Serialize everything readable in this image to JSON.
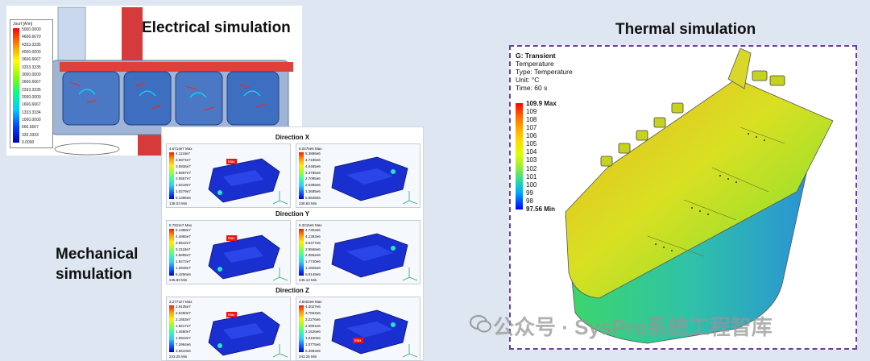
{
  "labels": {
    "electrical": "Electrical simulation",
    "mechanical_line1": "Mechanical",
    "mechanical_line2": "simulation",
    "thermal": "Thermal simulation"
  },
  "electrical_legend": {
    "title": "Jourf [A/m]",
    "values": [
      "5000.0000",
      "4666.6670",
      "4333.3335",
      "4000.0000",
      "3666.6667",
      "3333.3335",
      "3000.0000",
      "2666.6667",
      "2333.3335",
      "2000.0000",
      "1666.6667",
      "1333.3334",
      "1000.0000",
      "666.6667",
      "333.3333",
      "0.0000"
    ]
  },
  "mechanical": {
    "rows": [
      {
        "title": "Direction X",
        "left": {
          "header": "4.6714e7 Max",
          "values": [
            "4.1116e7",
            "3.5874e7",
            "3.0836e7",
            "2.5897e7",
            "2.0557e7",
            "1.5418e7",
            "1.0279e7",
            "5.1396e6"
          ],
          "footer": "138.03 Min"
        },
        "right": {
          "header": "6.0475e6 Max",
          "values": [
            "5.3886e6",
            "4.7186e6",
            "4.0485e6",
            "3.3785e6",
            "2.7085e6",
            "2.0385e6",
            "1.3685e6",
            "6.9848e5"
          ],
          "footer": "238.83 Min"
        }
      },
      {
        "title": "Direction Y",
        "left": {
          "header": "5.7811e7 Max",
          "values": [
            "5.1388e7",
            "4.4965e7",
            "3.8542e7",
            "3.2118e7",
            "2.5695e7",
            "1.9272e7",
            "1.2849e7",
            "6.4256e6"
          ],
          "footer": "245.93 Min"
        },
        "right": {
          "header": "5.3215e6 Max",
          "values": [
            "4.7303e6",
            "4.1392e6",
            "3.5477e6",
            "2.9566e6",
            "2.3652e6",
            "1.7740e6",
            "1.1825e6",
            "5.9149e5"
          ],
          "footer": "245.13 Min"
        }
      },
      {
        "title": "Direction Z",
        "left": {
          "header": "3.2771e7 Max",
          "values": [
            "2.9135e7",
            "2.5490e7",
            "2.1853e7",
            "1.8217e7",
            "1.4580e7",
            "1.0943e7",
            "7.2984e6",
            "3.6610e6"
          ],
          "footer": "243.25 Min"
        },
        "right": {
          "header": "4.8402e6 Max",
          "values": [
            "4.3027e6",
            "3.7652e6",
            "3.2276e6",
            "2.6901e6",
            "2.1526e6",
            "1.6150e6",
            "1.0775e6",
            "5.3994e5"
          ],
          "footer": "243.25 Min"
        }
      }
    ],
    "max_tag": "Max"
  },
  "thermal": {
    "header": "G: Transient",
    "lines": [
      "Temperature",
      "Type: Temperature",
      "Unit: °C",
      "Time: 60 s"
    ],
    "legend": [
      "109.9 Max",
      "109",
      "108",
      "107",
      "106",
      "105",
      "104",
      "103",
      "102",
      "101",
      "100",
      "99",
      "98",
      "97.56 Min"
    ]
  },
  "watermark": "公众号 · SysPro系统工程智库"
}
